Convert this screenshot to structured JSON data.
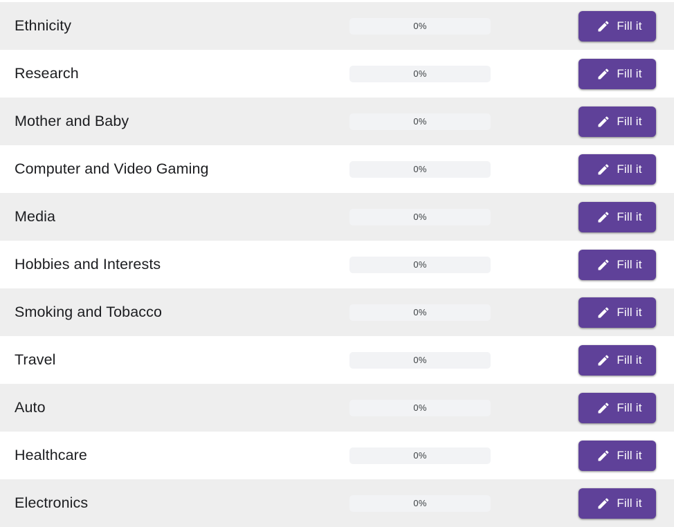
{
  "page": {
    "background": "#ffffff",
    "accent_color": "#5f4199",
    "stripe_color": "#eeeeee",
    "progress_track_color": "#f2f3f5",
    "label_color": "#1c1d20"
  },
  "button": {
    "label": "Fill it",
    "icon": "pencil-icon"
  },
  "rows": [
    {
      "category": "Ethnicity",
      "progress_label": "0%",
      "progress_value": 0
    },
    {
      "category": "Research",
      "progress_label": "0%",
      "progress_value": 0
    },
    {
      "category": "Mother and Baby",
      "progress_label": "0%",
      "progress_value": 0
    },
    {
      "category": "Computer and Video Gaming",
      "progress_label": "0%",
      "progress_value": 0
    },
    {
      "category": "Media",
      "progress_label": "0%",
      "progress_value": 0
    },
    {
      "category": "Hobbies and Interests",
      "progress_label": "0%",
      "progress_value": 0
    },
    {
      "category": "Smoking and Tobacco",
      "progress_label": "0%",
      "progress_value": 0
    },
    {
      "category": "Travel",
      "progress_label": "0%",
      "progress_value": 0
    },
    {
      "category": "Auto",
      "progress_label": "0%",
      "progress_value": 0
    },
    {
      "category": "Healthcare",
      "progress_label": "0%",
      "progress_value": 0
    },
    {
      "category": "Electronics",
      "progress_label": "0%",
      "progress_value": 0
    }
  ]
}
